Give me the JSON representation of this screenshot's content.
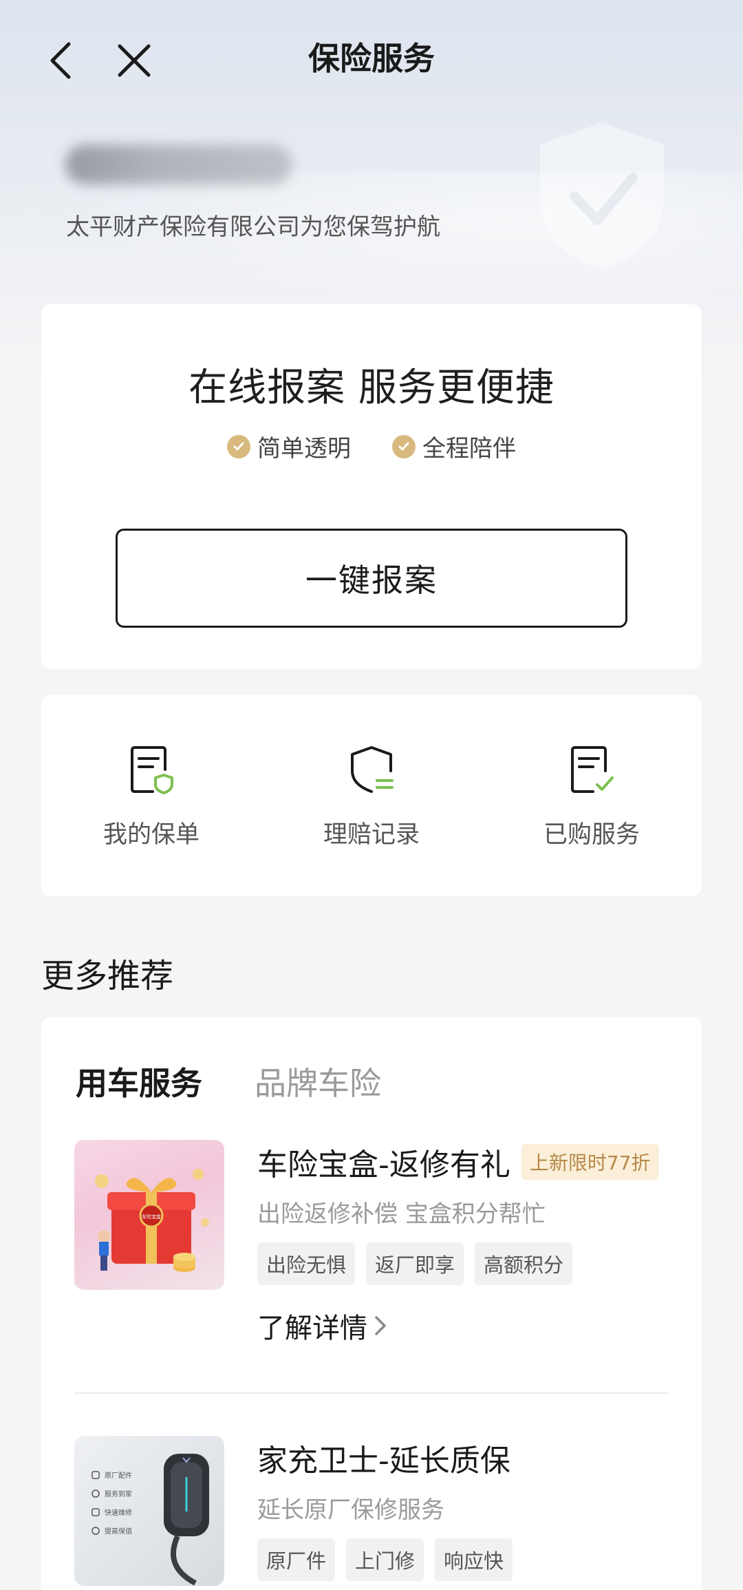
{
  "header": {
    "title": "保险服务"
  },
  "account": {
    "provider_line": "太平财产保险有限公司为您保驾护航"
  },
  "report_card": {
    "title": "在线报案 服务更便捷",
    "features": [
      "简单透明",
      "全程陪伴"
    ],
    "button_label": "一键报案"
  },
  "quick_actions": [
    {
      "label": "我的保单",
      "icon": "policy-doc-icon"
    },
    {
      "label": "理赔记录",
      "icon": "claim-shield-icon"
    },
    {
      "label": "已购服务",
      "icon": "purchased-doc-icon"
    }
  ],
  "more": {
    "section_title": "更多推荐",
    "tabs": [
      "用车服务",
      "品牌车险"
    ],
    "active_tab": "用车服务",
    "products": [
      {
        "title": "车险宝盒-返修有礼",
        "badge": "上新限时77折",
        "subtitle": "出险返修补偿 宝盒积分帮忙",
        "tags": [
          "出险无惧",
          "返厂即享",
          "高额积分"
        ],
        "more_label": "了解详情",
        "gift_label": "车险宝盒"
      },
      {
        "title": "家充卫士-延长质保",
        "subtitle": "延长原厂保修服务",
        "tags": [
          "原厂件",
          "上门修",
          "响应快"
        ],
        "thumb_lines": [
          "原厂配件",
          "服务到家",
          "快速维修",
          "提高保值"
        ]
      }
    ]
  },
  "colors": {
    "accent_gold": "#d8b97e",
    "badge_bg": "#fbefd9",
    "icon_green": "#7cc04f"
  }
}
